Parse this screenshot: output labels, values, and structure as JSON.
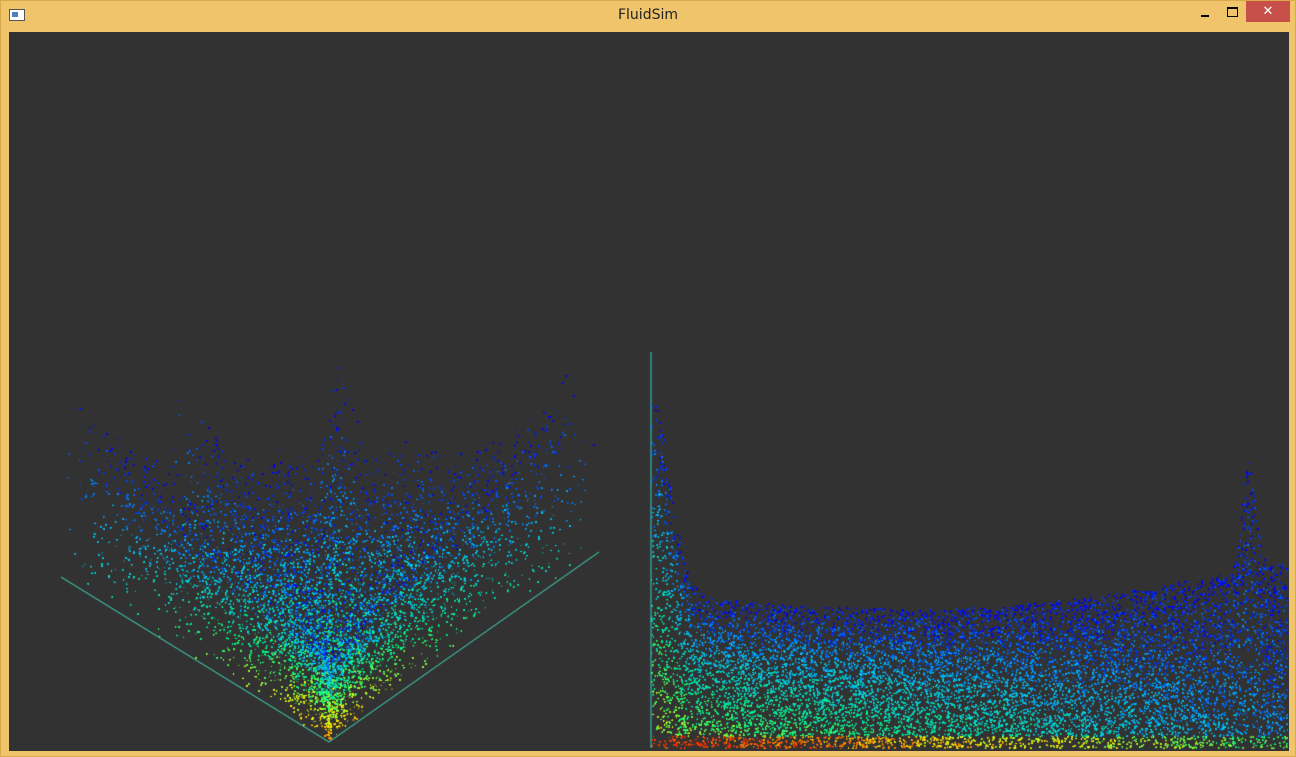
{
  "window": {
    "title": "FluidSim",
    "controls": {
      "minimize_icon": "minimize-icon",
      "maximize_icon": "maximize-icon",
      "close_glyph": "✕"
    }
  },
  "viewport": {
    "background": "#323232",
    "views": [
      "perspective-view",
      "side-view"
    ],
    "color_scale": [
      "#0000ff",
      "#00c8ff",
      "#00ff80",
      "#ffff00",
      "#ff3000"
    ]
  },
  "colors": {
    "frame": "#f0c46a",
    "close_button": "#c7504b"
  }
}
